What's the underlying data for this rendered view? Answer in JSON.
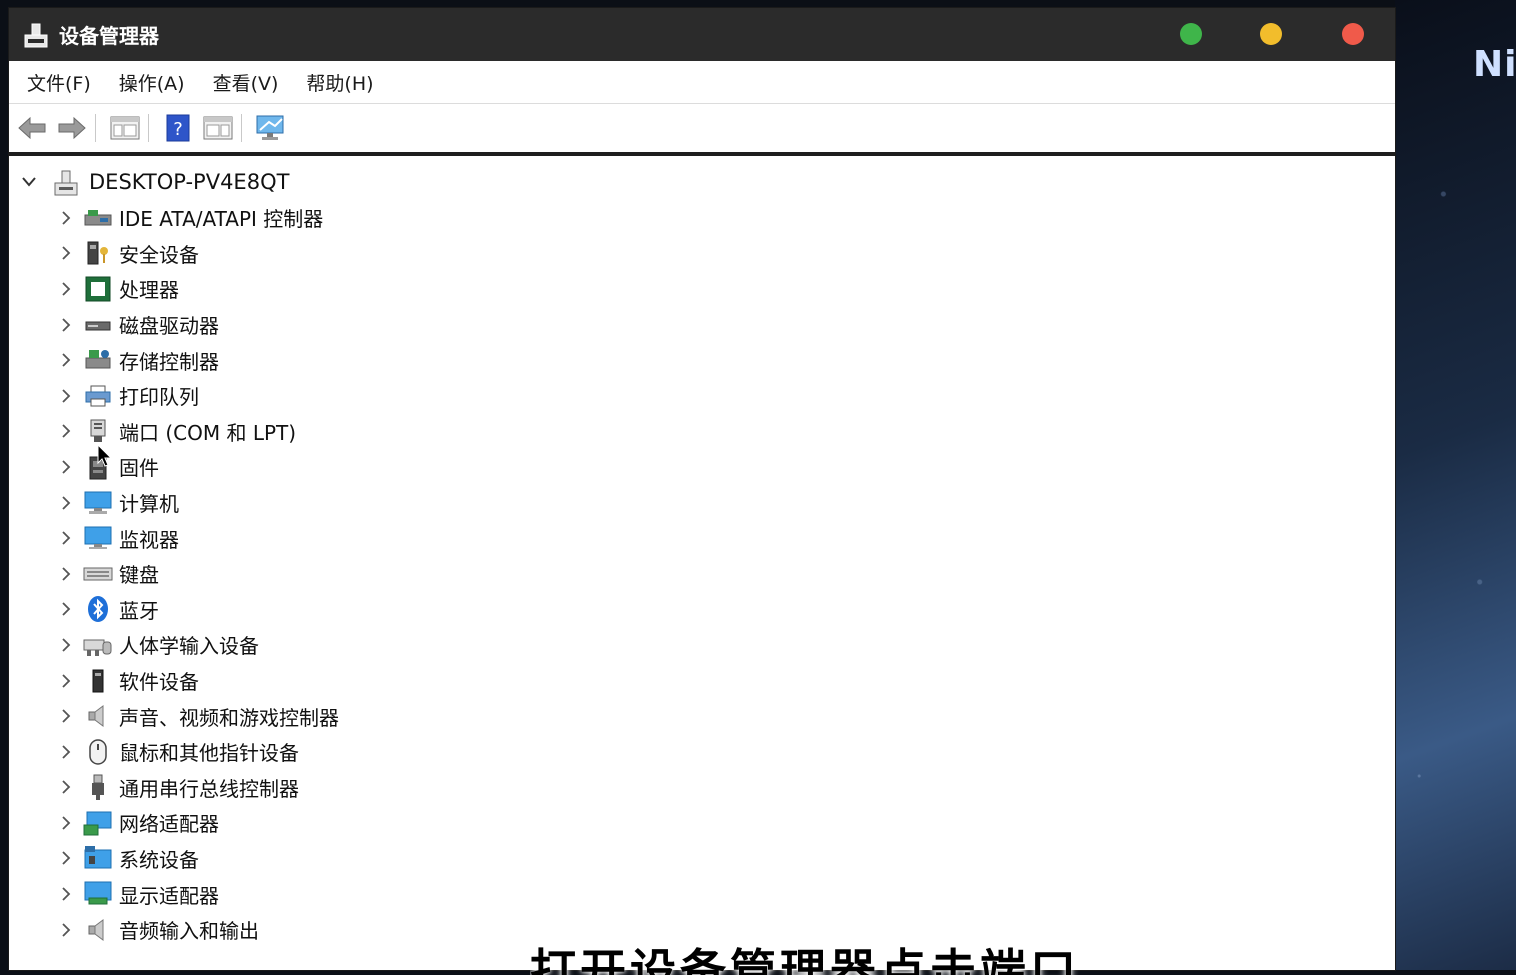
{
  "window": {
    "title": "设备管理器"
  },
  "menu": [
    "文件(F)",
    "操作(A)",
    "查看(V)",
    "帮助(H)"
  ],
  "tree": {
    "root": "DESKTOP-PV4E8QT",
    "items": [
      {
        "label": "IDE ATA/ATAPI 控制器",
        "icon": "ide-controller-icon"
      },
      {
        "label": "安全设备",
        "icon": "security-device-icon"
      },
      {
        "label": "处理器",
        "icon": "processor-icon"
      },
      {
        "label": "磁盘驱动器",
        "icon": "disk-drive-icon"
      },
      {
        "label": "存储控制器",
        "icon": "storage-controller-icon"
      },
      {
        "label": "打印队列",
        "icon": "printer-icon"
      },
      {
        "label": "端口 (COM 和 LPT)",
        "icon": "port-icon"
      },
      {
        "label": "固件",
        "icon": "firmware-icon"
      },
      {
        "label": "计算机",
        "icon": "computer-icon"
      },
      {
        "label": "监视器",
        "icon": "monitor-icon"
      },
      {
        "label": "键盘",
        "icon": "keyboard-icon"
      },
      {
        "label": "蓝牙",
        "icon": "bluetooth-icon"
      },
      {
        "label": "人体学输入设备",
        "icon": "hid-icon"
      },
      {
        "label": "软件设备",
        "icon": "software-device-icon"
      },
      {
        "label": "声音、视频和游戏控制器",
        "icon": "speaker-icon"
      },
      {
        "label": "鼠标和其他指针设备",
        "icon": "mouse-icon"
      },
      {
        "label": "通用串行总线控制器",
        "icon": "usb-icon"
      },
      {
        "label": "网络适配器",
        "icon": "network-adapter-icon"
      },
      {
        "label": "系统设备",
        "icon": "system-device-icon"
      },
      {
        "label": "显示适配器",
        "icon": "display-adapter-icon"
      },
      {
        "label": "音频输入和输出",
        "icon": "audio-io-icon"
      }
    ]
  },
  "desktop_text": "Ni",
  "caption": "打开设备管理器点击端口",
  "colors": {
    "titlebar": "#2b2b2b",
    "close": "#f05a4a",
    "minimize": "#f2bd2c",
    "maximize": "#3fb54a"
  }
}
